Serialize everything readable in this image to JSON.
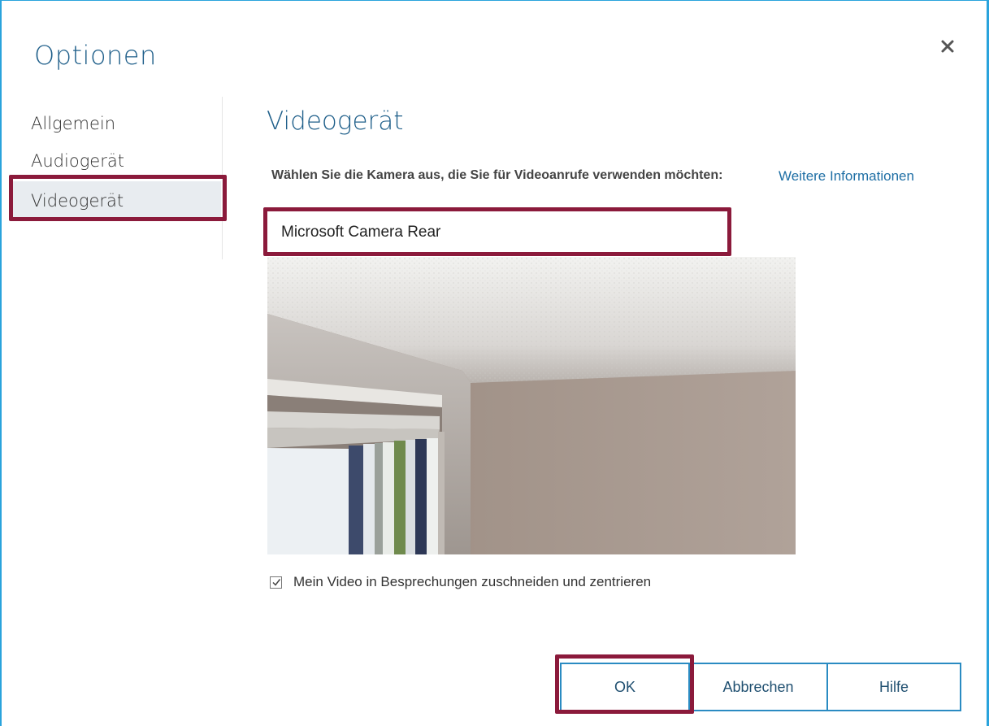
{
  "dialog": {
    "title": "Optionen",
    "close_icon": "close-icon"
  },
  "sidebar": {
    "items": [
      {
        "label": "Allgemein",
        "selected": false
      },
      {
        "label": "Audiogerät",
        "selected": false
      },
      {
        "label": "Videogerät",
        "selected": true
      }
    ]
  },
  "video": {
    "section_title": "Videogerät",
    "prompt": "Wählen Sie die Kamera aus, die Sie für Videoanrufe verwenden möchten:",
    "more_info_link": "Weitere Informationen",
    "camera_selected": "Microsoft Camera Rear",
    "crop_checkbox": {
      "label": "Mein Video in Besprechungen zuschneiden und zentrieren",
      "checked": true
    }
  },
  "buttons": {
    "ok": "OK",
    "cancel": "Abbrechen",
    "help": "Hilfe"
  },
  "colors": {
    "accent": "#2aa3dc",
    "title": "#1f5f8a",
    "highlight": "#8b1a3b",
    "link": "#1f6fa5"
  }
}
